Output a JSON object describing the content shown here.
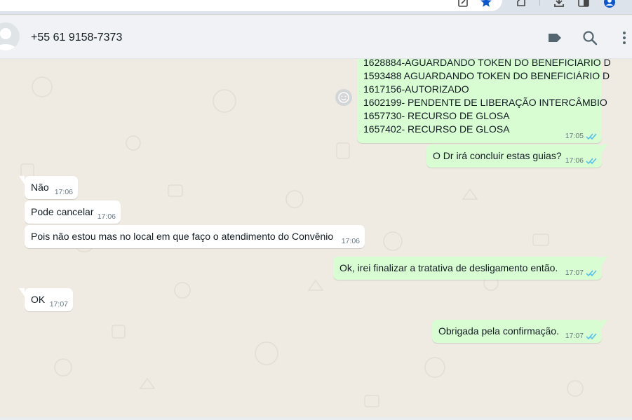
{
  "header": {
    "contact_name": "+55 61 9158-7373"
  },
  "messages": [
    {
      "direction": "out",
      "lines": [
        "1628884-AGUARDANDO TOKEN DO BENEFICIÁRIO D",
        "1593488 AGUARDANDO TOKEN DO BENEFICIÁRIO D",
        "1617156-AUTORIZADO",
        "1602199- PENDENTE DE LIBERAÇÃO INTERCÂMBIO",
        "1657730- RECURSO DE GLOSA",
        "1657402-  RECURSO DE GLOSA"
      ],
      "time": "17:05",
      "status": "read"
    },
    {
      "direction": "out",
      "text": "O Dr irá concluir estas guias?",
      "time": "17:06",
      "status": "read"
    },
    {
      "direction": "in",
      "text": "Não",
      "time": "17:06"
    },
    {
      "direction": "in",
      "text": "Pode cancelar",
      "time": "17:06"
    },
    {
      "direction": "in",
      "text": "Pois não estou mas no local em que faço o atendimento do Convênio",
      "time": "17:06"
    },
    {
      "direction": "out",
      "text": "Ok, irei finalizar a tratativa de desligamento então.",
      "time": "17:07",
      "status": "read"
    },
    {
      "direction": "in",
      "text": "OK",
      "time": "17:07"
    },
    {
      "direction": "out",
      "text": "Obrigada pela confirmação.",
      "time": "17:07",
      "status": "read"
    }
  ],
  "icons": {
    "label": "label-icon",
    "search": "search-icon",
    "menu": "more-vert-icon",
    "reaction": "emoji-reaction-icon",
    "read_receipt": "double-check-icon"
  },
  "colors": {
    "incoming_bubble": "#ffffff",
    "outgoing_bubble": "#d9fdd3",
    "read_tick": "#53bdeb",
    "chat_background": "#efeae2",
    "header_background": "#f0f2f5"
  }
}
